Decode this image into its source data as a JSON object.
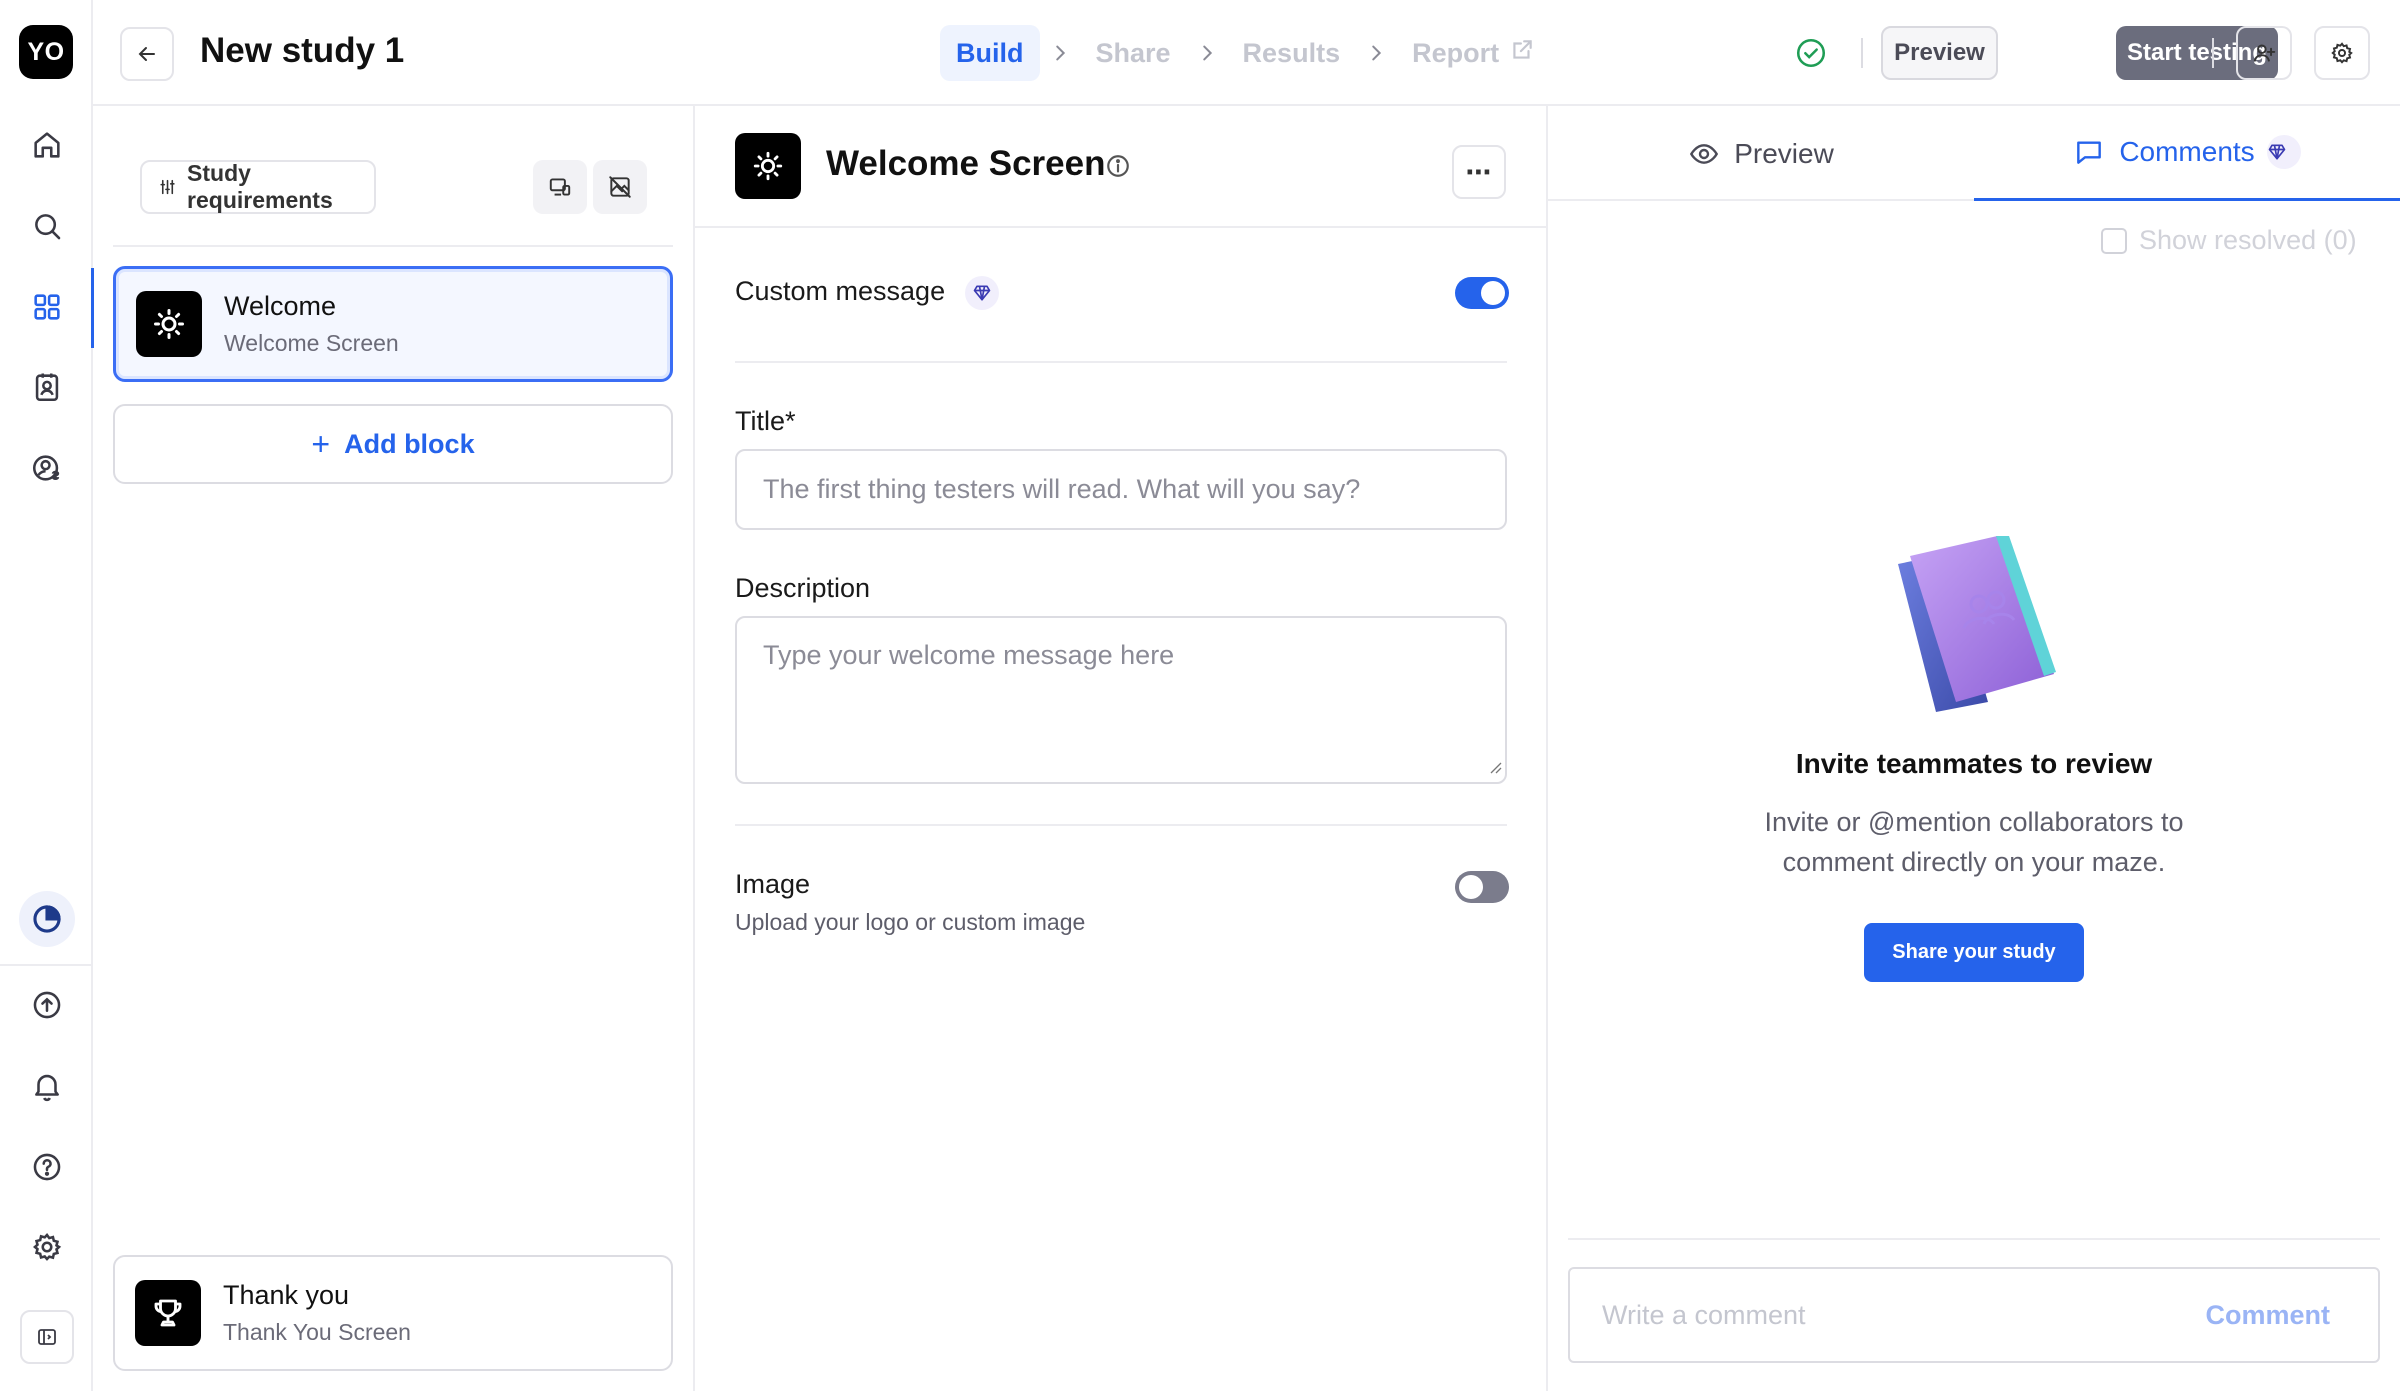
{
  "app": {
    "logo_text": "YO"
  },
  "header": {
    "study_title": "New study 1",
    "steps": [
      {
        "label": "Build",
        "active": true
      },
      {
        "label": "Share",
        "active": false
      },
      {
        "label": "Results",
        "active": false
      },
      {
        "label": "Report",
        "active": false,
        "external": true
      }
    ],
    "preview_label": "Preview",
    "start_label": "Start testing"
  },
  "left_panel": {
    "requirements_label": "Study requirements",
    "blocks": [
      {
        "name": "Welcome",
        "type": "Welcome Screen",
        "icon": "sun-icon",
        "selected": true
      }
    ],
    "add_block_label": "Add block",
    "end_block": {
      "name": "Thank you",
      "type": "Thank You Screen",
      "icon": "trophy-icon"
    }
  },
  "editor": {
    "title": "Welcome Screen",
    "custom_message_label": "Custom message",
    "custom_message_on": true,
    "title_label": "Title*",
    "title_placeholder": "The first thing testers will read. What will you say?",
    "description_label": "Description",
    "description_placeholder": "Type your welcome message here",
    "image_label": "Image",
    "image_sub": "Upload your logo or custom image",
    "image_on": false
  },
  "right_panel": {
    "tab_preview": "Preview",
    "tab_comments": "Comments",
    "show_resolved": "Show resolved (0)",
    "invite_title": "Invite teammates to review",
    "invite_text": "Invite or @mention collaborators to comment directly on your maze.",
    "share_button": "Share your study",
    "comment_placeholder": "Write a comment",
    "comment_button": "Comment"
  },
  "colors": {
    "accent": "#2563eb",
    "start_button": "#6b6d7d",
    "premium": "#3b3bb3"
  }
}
